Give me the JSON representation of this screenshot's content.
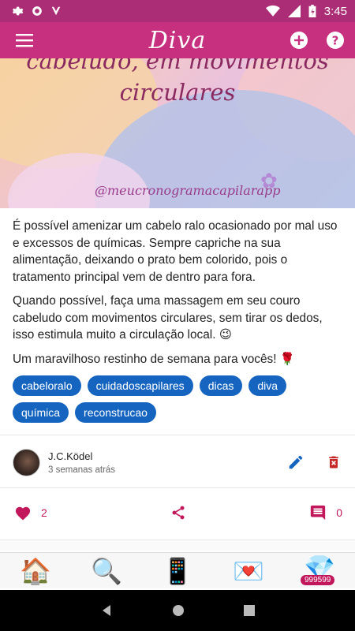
{
  "status": {
    "time": "3:45"
  },
  "appbar": {
    "title": "Diva"
  },
  "hero": {
    "line1": "cabeludo, em movimentos",
    "line2": "circulares",
    "handle": "@meucronogramacapilarapp"
  },
  "post": {
    "paragraphs": [
      "É possível amenizar um cabelo ralo ocasionado por mal uso e excessos de químicas. Sempre capriche na sua alimentação, deixando o prato bem colorido, pois o tratamento principal vem de dentro para fora.",
      "Quando possível, faça uma massagem em seu couro cabeludo com movimentos circulares, sem tirar os dedos, isso estimula muito a circulação local. 😉",
      "Um maravilhoso restinho de semana para vocês! 🌹"
    ],
    "tags": [
      "cabeloralo",
      "cuidadoscapilares",
      "dicas",
      "diva",
      "química",
      "reconstrucao"
    ]
  },
  "author": {
    "name": "J.C.Ködel",
    "time": "3 semanas atrás"
  },
  "actions": {
    "likes": "2",
    "comments": "0"
  },
  "bottom_nav": {
    "gems": "999599"
  },
  "colors": {
    "primary": "#c7307f",
    "status_bar": "#ab2d75",
    "tag": "#1565c0",
    "accent": "#c2185b"
  }
}
